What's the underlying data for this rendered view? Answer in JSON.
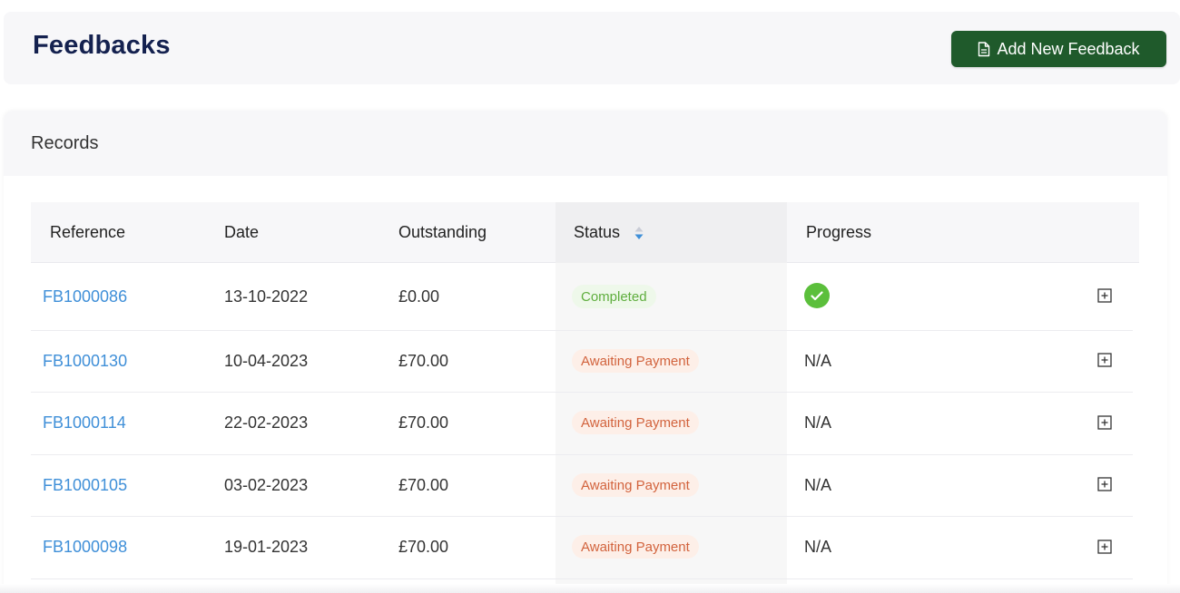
{
  "header": {
    "title": "Feedbacks",
    "add_button_label": "Add New Feedback",
    "add_button_icon": "document-icon"
  },
  "records": {
    "title": "Records",
    "columns": [
      "Reference",
      "Date",
      "Outstanding",
      "Status",
      "Progress"
    ],
    "sort_icon": "sort-icon",
    "rows": [
      {
        "reference": "FB1000086",
        "date": "13-10-2022",
        "outstanding": "£0.00",
        "status": "Completed",
        "progress": "check-icon"
      },
      {
        "reference": "FB1000130",
        "date": "10-04-2023",
        "outstanding": "£70.00",
        "status": "Awaiting Payment",
        "progress": "N/A"
      },
      {
        "reference": "FB1000114",
        "date": "22-02-2023",
        "outstanding": "£70.00",
        "status": "Awaiting Payment",
        "progress": "N/A"
      },
      {
        "reference": "FB1000105",
        "date": "03-02-2023",
        "outstanding": "£70.00",
        "status": "Awaiting Payment",
        "progress": "N/A"
      },
      {
        "reference": "FB1000098",
        "date": "19-01-2023",
        "outstanding": "£70.00",
        "status": "Awaiting Payment",
        "progress": "N/A"
      }
    ]
  },
  "colors": {
    "title": "#14214f",
    "button": "#1f5a2b",
    "link": "#3f8fd8",
    "completed": "#5fae3e",
    "awaiting": "#d2633d",
    "check": "#5bbf3b"
  }
}
